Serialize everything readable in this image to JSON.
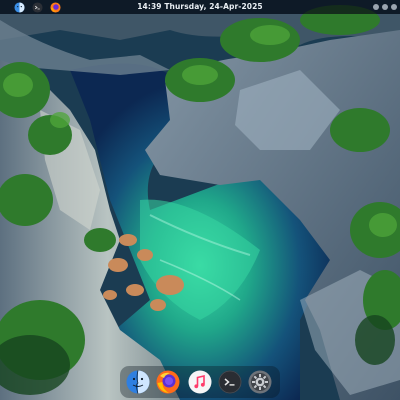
{
  "topbar": {
    "clock": "14:39  Thursday, 24-Apr-2025",
    "launchers": [
      {
        "name": "finder-icon"
      },
      {
        "name": "terminal-icon"
      },
      {
        "name": "firefox-icon"
      }
    ],
    "tray_icons": [
      "network-icon",
      "volume-icon",
      "power-icon"
    ]
  },
  "dock": {
    "items": [
      {
        "name": "finder-icon",
        "app": "Finder"
      },
      {
        "name": "firefox-icon",
        "app": "Firefox"
      },
      {
        "name": "music-icon",
        "app": "Music"
      },
      {
        "name": "terminal-icon",
        "app": "Terminal"
      },
      {
        "name": "settings-icon",
        "app": "Settings"
      }
    ]
  },
  "colors": {
    "topbar_bg": "#0a0e16",
    "water_deep": "#0f2b5a",
    "water_shallow": "#2fd3a0",
    "forest": "#2f7a2c",
    "cliff": "#8fa3b3"
  }
}
